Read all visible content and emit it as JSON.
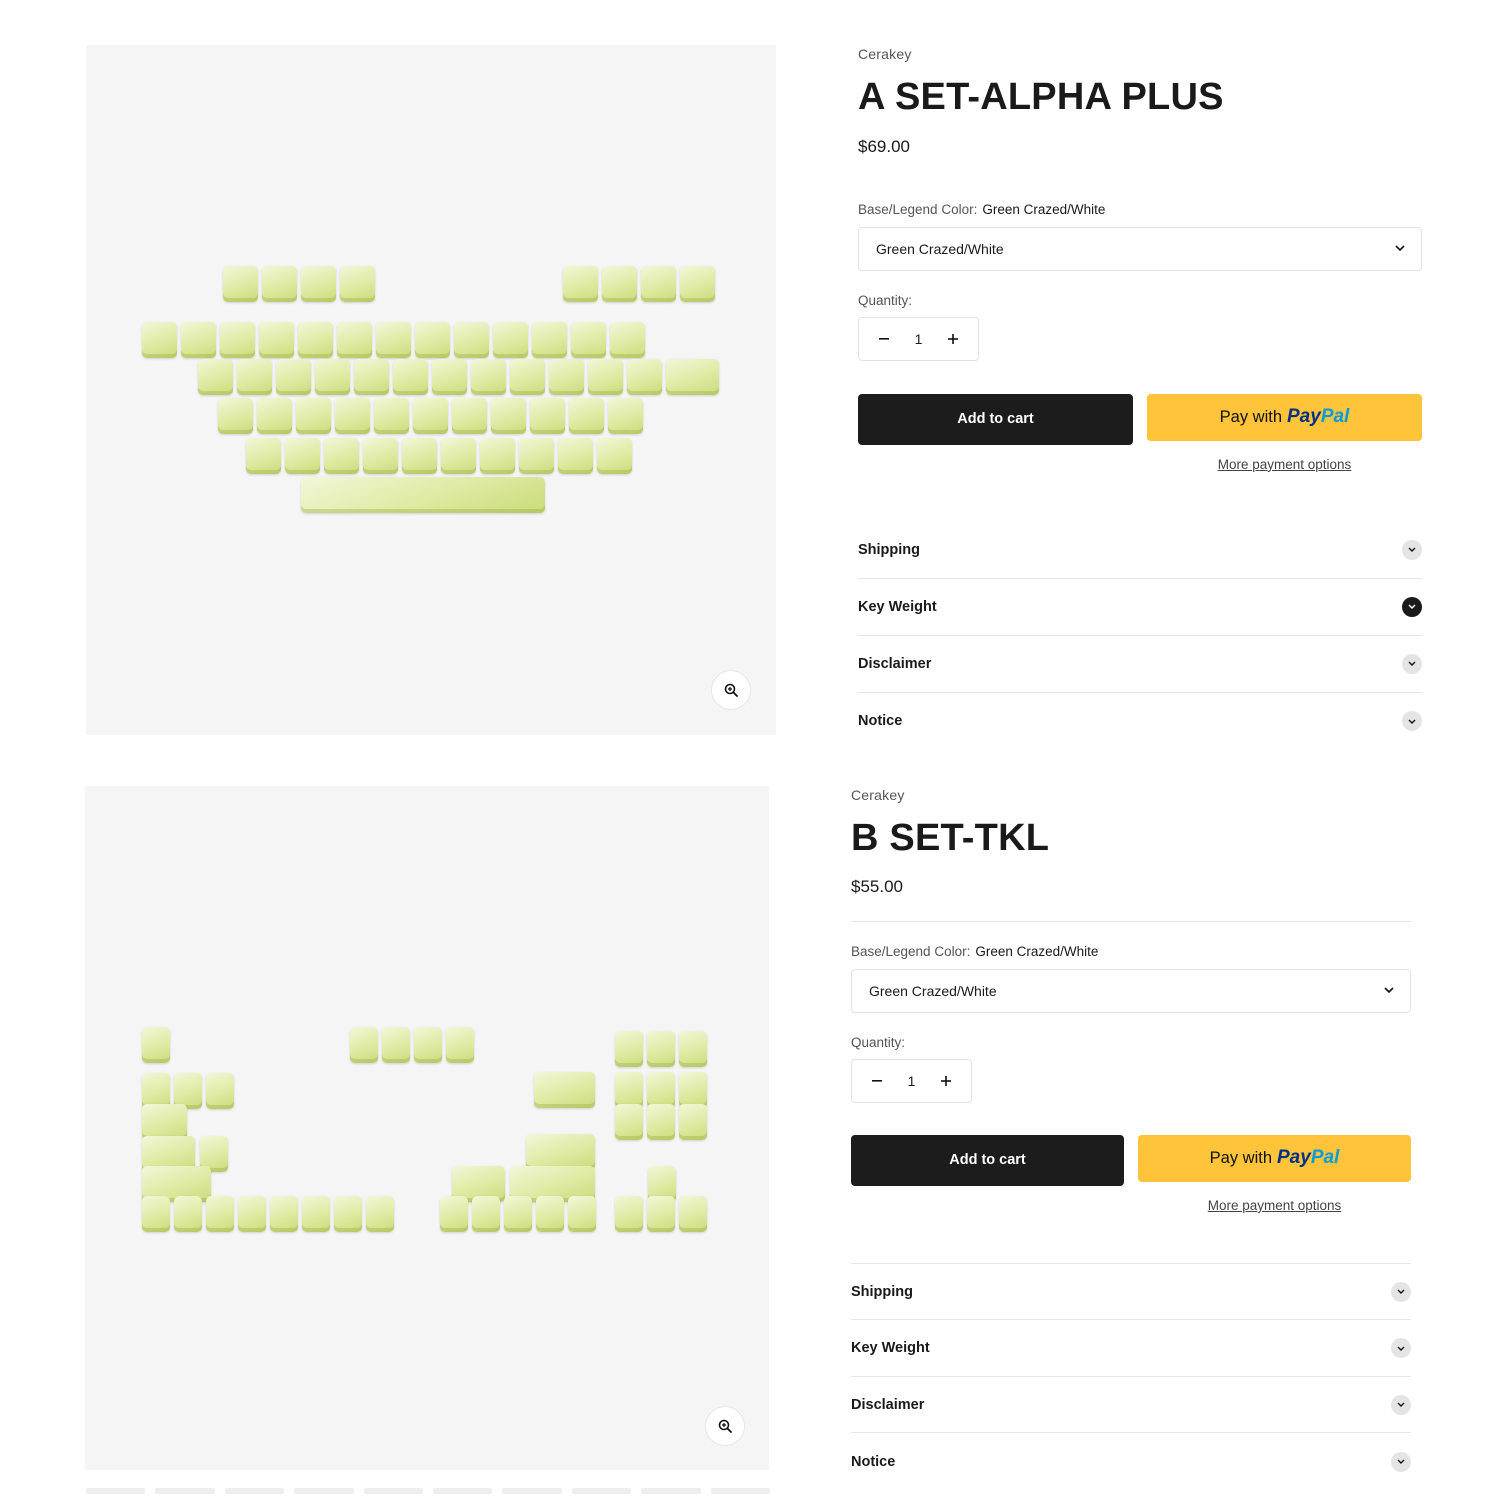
{
  "products": [
    {
      "vendor": "Cerakey",
      "title": "A SET-ALPHA PLUS",
      "price": "$69.00",
      "option_label": "Base/Legend Color:",
      "option_value": "Green Crazed/White",
      "select_value": "Green Crazed/White",
      "quantity_label": "Quantity:",
      "quantity": "1",
      "add_to_cart": "Add to cart",
      "paypal_prefix": "Pay with",
      "paypal_brand_a": "Pay",
      "paypal_brand_b": "Pal",
      "more_payment": "More payment options",
      "accordion": [
        "Shipping",
        "Key Weight",
        "Disclaimer",
        "Notice"
      ],
      "active_accordion": "Key Weight"
    },
    {
      "vendor": "Cerakey",
      "title": "B SET-TKL",
      "price": "$55.00",
      "option_label": "Base/Legend Color:",
      "option_value": "Green Crazed/White",
      "select_value": "Green Crazed/White",
      "quantity_label": "Quantity:",
      "quantity": "1",
      "add_to_cart": "Add to cart",
      "paypal_prefix": "Pay with",
      "paypal_brand_a": "Pay",
      "paypal_brand_b": "Pal",
      "more_payment": "More payment options",
      "accordion": [
        "Shipping",
        "Key Weight",
        "Disclaimer",
        "Notice"
      ]
    }
  ],
  "icons": {
    "zoom": "zoom-in-icon",
    "select": "chevron-down-icon",
    "accordion": "chevron-down-icon",
    "minus": "minus-icon",
    "plus": "plus-icon"
  },
  "colors": {
    "cart_button": "#1c1c1c",
    "paypal_button": "#ffc439",
    "paypal_blue": "#003087",
    "paypal_light_blue": "#009cde",
    "media_bg": "#f5f5f5",
    "keycap_green": "#dfeaa2"
  }
}
